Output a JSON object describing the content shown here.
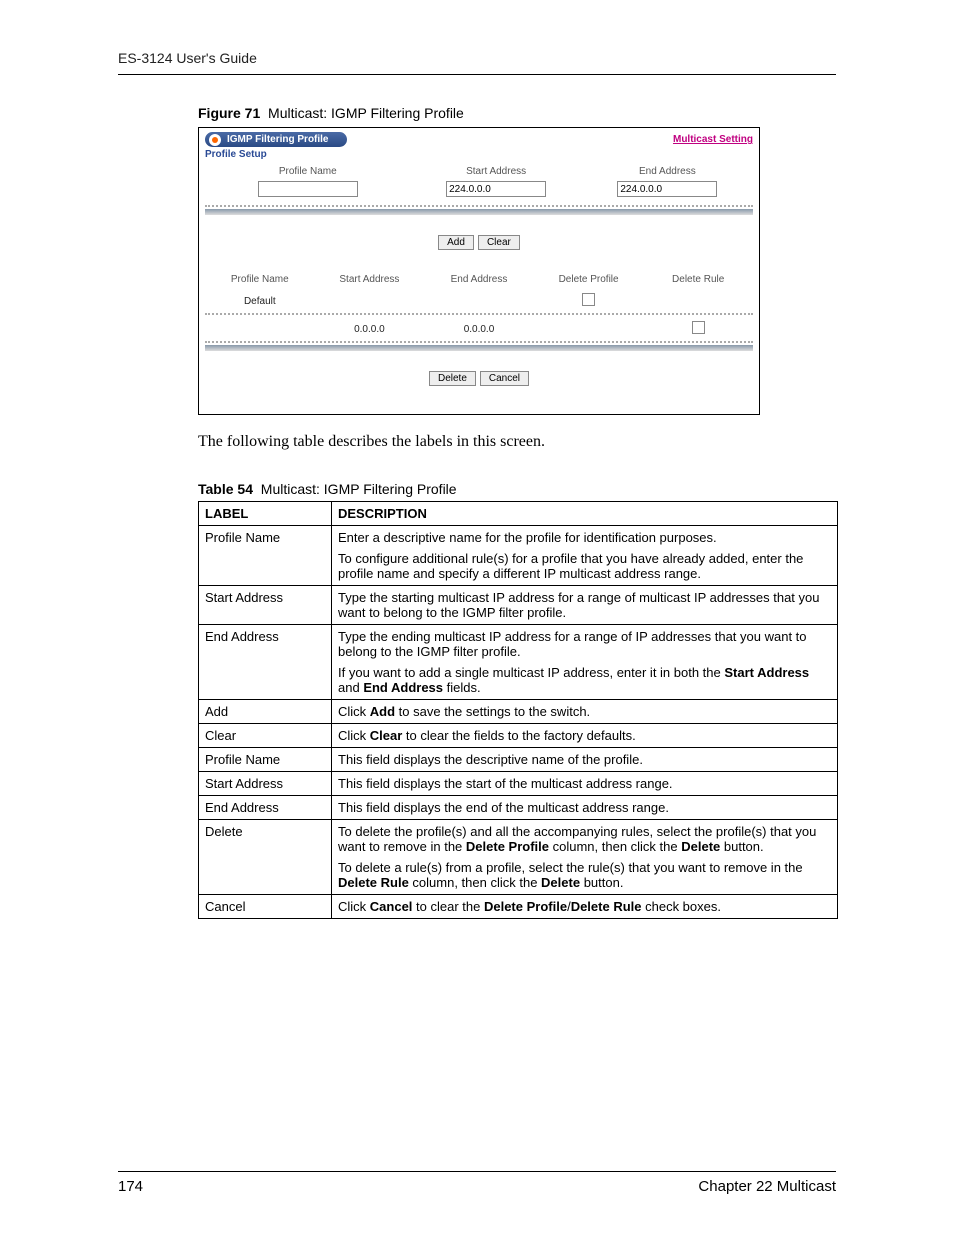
{
  "header": {
    "doc_title": "ES-3124 User's Guide"
  },
  "figure": {
    "label": "Figure 71",
    "title": "Multicast: IGMP Filtering Profile"
  },
  "screenshot": {
    "tab_title": "IGMP Filtering Profile",
    "link": "Multicast Setting",
    "section_label": "Profile Setup",
    "top_headers": {
      "pn": "Profile Name",
      "sa": "Start Address",
      "ea": "End Address"
    },
    "inputs": {
      "pn": "",
      "sa": "224.0.0.0",
      "ea": "224.0.0.0"
    },
    "buttons": {
      "add": "Add",
      "clear": "Clear",
      "delete": "Delete",
      "cancel": "Cancel"
    },
    "list_headers": {
      "pn": "Profile Name",
      "sa": "Start Address",
      "ea": "End Address",
      "dp": "Delete Profile",
      "dr": "Delete Rule"
    },
    "rows": [
      {
        "pn": "Default",
        "sa": "",
        "ea": "",
        "dp": true,
        "dr": false
      },
      {
        "pn": "",
        "sa": "0.0.0.0",
        "ea": "0.0.0.0",
        "dp": false,
        "dr": true
      }
    ]
  },
  "body_text": "The following table describes the labels in this screen.",
  "table": {
    "label": "Table 54",
    "title": "Multicast: IGMP Filtering Profile",
    "head": {
      "c1": "LABEL",
      "c2": "DESCRIPTION"
    },
    "rows": [
      {
        "label": "Profile Name",
        "desc": [
          {
            "t": "Enter a descriptive name for the profile for identification purposes."
          },
          {
            "t": "To configure additional rule(s) for a profile that you have already added, enter the profile name and specify a different IP multicast address range."
          }
        ]
      },
      {
        "label": "Start Address",
        "desc": [
          {
            "t": "Type the starting multicast IP address for a range of multicast IP addresses that you want to belong to the IGMP filter profile."
          }
        ]
      },
      {
        "label": "End Address",
        "desc": [
          {
            "t": "Type the ending multicast IP address for a range of IP addresses that you want to belong to the IGMP filter profile."
          },
          {
            "html": "If you want to add a single multicast IP address, enter it in both the <b>Start Address</b> and <b>End Address</b> fields."
          }
        ]
      },
      {
        "label": "Add",
        "desc": [
          {
            "html": "Click <b>Add</b> to save the settings to the switch."
          }
        ]
      },
      {
        "label": "Clear",
        "desc": [
          {
            "html": "Click <b>Clear</b> to clear the fields to the factory defaults."
          }
        ]
      },
      {
        "label": "Profile Name",
        "desc": [
          {
            "t": "This field displays the descriptive name of the profile."
          }
        ]
      },
      {
        "label": "Start Address",
        "desc": [
          {
            "t": "This field displays the start of the multicast address range."
          }
        ]
      },
      {
        "label": "End Address",
        "desc": [
          {
            "t": "This field displays the end of the multicast address range."
          }
        ]
      },
      {
        "label": "Delete",
        "desc": [
          {
            "html": "To delete the profile(s) and all the accompanying rules, select the profile(s) that you want to remove in the <b>Delete Profile</b> column, then click the <b>Delete</b> button."
          },
          {
            "html": "To delete a rule(s) from a profile, select the rule(s) that you want to remove in the <b>Delete Rule</b> column, then click the <b>Delete</b> button."
          }
        ]
      },
      {
        "label": "Cancel",
        "desc": [
          {
            "html": "Click <b>Cancel</b> to clear the <b>Delete Profile</b>/<b>Delete Rule</b> check boxes."
          }
        ]
      }
    ]
  },
  "footer": {
    "page": "174",
    "chapter": "Chapter 22 Multicast"
  }
}
